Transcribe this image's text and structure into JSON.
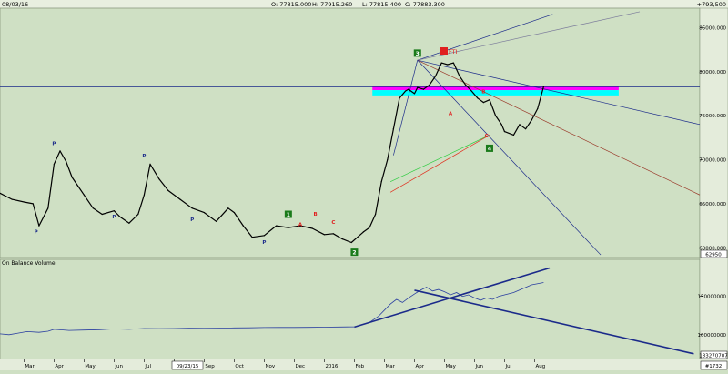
{
  "header": {
    "date": "08/03/16",
    "open": "O: 77815.000",
    "high": "H: 77915.260",
    "low": "L: 77815.400",
    "close": "C: 77883.300",
    "corner_value": "+793,500"
  },
  "colors": {
    "background": "#cfe0c4",
    "price": "#000000",
    "horizontal_line": "#1b2a8a",
    "magenta_band": "#ff00ff",
    "cyan_band": "#00ffff",
    "obv_line": "#2b3fa0",
    "obv_trend": "#1b2a8a",
    "wave_green_box": "#1a7a1a",
    "label_red": "#e02020"
  },
  "chart_data": [
    {
      "type": "line",
      "name": "price",
      "yticks": [
        "85000.000",
        "80000.000",
        "75000.000",
        "70000.000",
        "65000.000",
        "60000.000"
      ],
      "ytick_values": [
        85000,
        80000,
        75000,
        70000,
        65000,
        60000
      ],
      "ylim": [
        59000,
        87000
      ],
      "last_value_label": "62950",
      "xlabels": [
        "Mar",
        "Apr",
        "May",
        "Jun",
        "Jul",
        "Aug",
        "Sep",
        "Oct",
        "Nov",
        "Dec",
        "2016",
        "Feb",
        "Mar",
        "Apr",
        "May",
        "Jun",
        "Jul",
        "Aug"
      ],
      "xlabel_months": [
        2,
        3,
        4,
        5,
        6,
        7,
        8,
        9,
        10,
        11,
        12,
        13,
        14,
        15,
        16,
        17,
        18,
        19
      ],
      "xlim": [
        1.2,
        24.5
      ],
      "cursor_date_label": "09/23/15",
      "x": [
        1.2,
        1.6,
        2.0,
        2.3,
        2.5,
        2.8,
        3.0,
        3.2,
        3.4,
        3.6,
        3.8,
        4.0,
        4.3,
        4.6,
        5.0,
        5.2,
        5.5,
        5.8,
        6.0,
        6.2,
        6.5,
        6.8,
        7.2,
        7.6,
        8.0,
        8.4,
        8.8,
        9.0,
        9.3,
        9.6,
        10.0,
        10.4,
        10.8,
        11.2,
        11.6,
        12.0,
        12.3,
        12.6,
        12.9,
        13.1,
        13.3,
        13.5,
        13.7,
        13.9,
        14.1,
        14.3,
        14.5,
        14.7,
        14.8,
        15.0,
        15.1,
        15.3,
        15.5,
        15.7,
        15.9,
        16.1,
        16.3,
        16.5,
        16.7,
        16.9,
        17.1,
        17.3,
        17.5,
        17.7,
        17.9,
        18.0,
        18.3,
        18.5,
        18.7,
        18.9,
        19.1,
        19.3
      ],
      "values": [
        66200,
        65500,
        65200,
        65000,
        62500,
        64500,
        69500,
        71000,
        69800,
        68000,
        67000,
        66000,
        64500,
        63800,
        64200,
        63500,
        62800,
        63800,
        66000,
        69500,
        67800,
        66500,
        65500,
        64500,
        64000,
        63000,
        64500,
        64000,
        62500,
        61200,
        61400,
        62500,
        62300,
        62500,
        62200,
        61500,
        61600,
        61000,
        60600,
        61200,
        61800,
        62300,
        63800,
        67500,
        70000,
        73500,
        77000,
        77800,
        78000,
        77500,
        78200,
        78000,
        78500,
        79500,
        81000,
        80800,
        81000,
        79500,
        78500,
        77800,
        77000,
        76500,
        76800,
        75000,
        74000,
        73200,
        72800,
        74000,
        73500,
        74500,
        75800,
        78300
      ],
      "horizontal_line_value": 78300,
      "magenta_band": [
        77900,
        78400
      ],
      "cyan_band": [
        77300,
        77900
      ],
      "wave_labels": [
        {
          "text": "P",
          "x": 2.4,
          "y": 61800
        },
        {
          "text": "P",
          "x": 3.0,
          "y": 71800
        },
        {
          "text": "P",
          "x": 5.0,
          "y": 63500
        },
        {
          "text": "P",
          "x": 6.0,
          "y": 70400
        },
        {
          "text": "P",
          "x": 7.6,
          "y": 63200
        },
        {
          "text": "P",
          "x": 10.0,
          "y": 60600
        },
        {
          "text": "1",
          "x": 10.8,
          "y": 63700
        },
        {
          "text": "A",
          "x": 11.2,
          "y": 62600
        },
        {
          "text": "B",
          "x": 11.7,
          "y": 63800
        },
        {
          "text": "C",
          "x": 12.3,
          "y": 62900
        },
        {
          "text": "2",
          "x": 13.0,
          "y": 59400
        },
        {
          "text": "3",
          "x": 15.1,
          "y": 82000
        },
        {
          "text": "A",
          "x": 16.2,
          "y": 75200
        },
        {
          "text": "B",
          "x": 17.3,
          "y": 77700
        },
        {
          "text": "C",
          "x": 17.4,
          "y": 72700
        },
        {
          "text": "4",
          "x": 17.5,
          "y": 71200
        }
      ],
      "cursor_tag": "FTI"
    },
    {
      "type": "line",
      "title": "On Balance Volume",
      "yticks": [
        "150000000",
        "100000000"
      ],
      "ytick_values": [
        150000000,
        100000000
      ],
      "ylim": [
        70000000,
        190000000
      ],
      "last_value_label": "183270707",
      "x": [
        1.2,
        1.5,
        1.8,
        2.1,
        2.5,
        2.8,
        3.0,
        3.5,
        4.0,
        4.5,
        5.0,
        5.5,
        6.0,
        6.5,
        7.0,
        7.5,
        8.0,
        8.5,
        9.0,
        9.5,
        10.0,
        10.5,
        11.0,
        11.5,
        12.0,
        12.5,
        13.0,
        13.5,
        13.8,
        14.0,
        14.2,
        14.4,
        14.6,
        14.8,
        15.0,
        15.2,
        15.4,
        15.6,
        15.8,
        16.0,
        16.2,
        16.4,
        16.6,
        16.8,
        17.0,
        17.2,
        17.4,
        17.6,
        17.8,
        18.0,
        18.3,
        18.6,
        18.9,
        19.3
      ],
      "values": [
        101000000,
        100000000,
        102000000,
        104000000,
        103000000,
        104500000,
        107000000,
        105500000,
        106000000,
        106500000,
        107500000,
        107000000,
        108000000,
        107800000,
        108000000,
        108500000,
        108200000,
        108500000,
        108800000,
        109000000,
        109300000,
        109500000,
        109400000,
        109600000,
        109800000,
        110000000,
        110300000,
        116000000,
        124000000,
        132000000,
        140000000,
        146000000,
        142000000,
        148000000,
        153000000,
        158000000,
        162000000,
        157000000,
        159000000,
        156000000,
        152000000,
        155000000,
        150000000,
        152000000,
        148000000,
        145000000,
        148000000,
        146000000,
        150000000,
        152000000,
        155000000,
        160000000,
        165000000,
        168000000
      ],
      "right_edge_tag": "#1732"
    }
  ]
}
